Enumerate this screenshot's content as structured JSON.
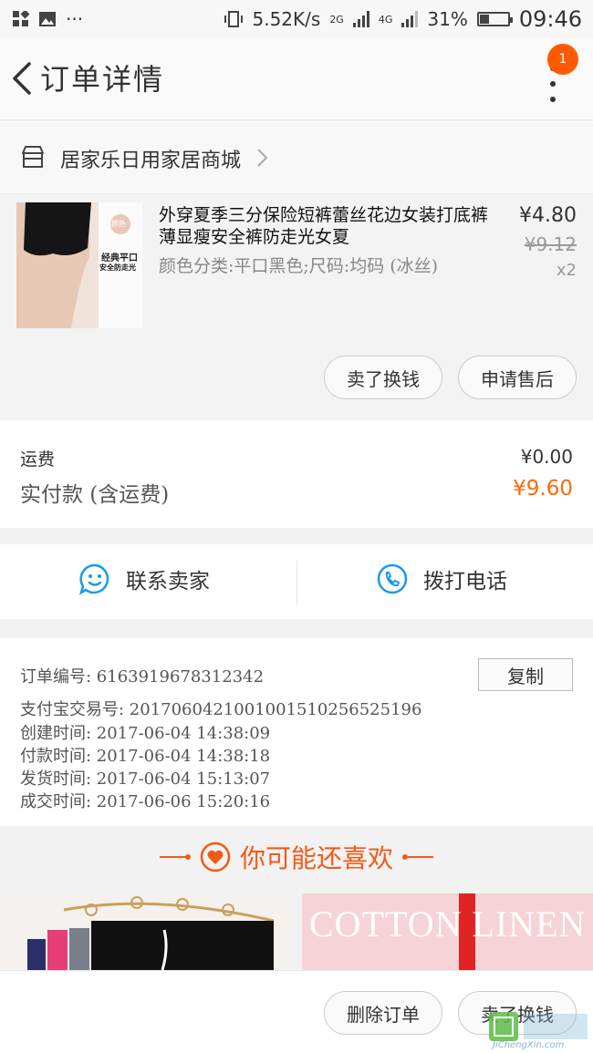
{
  "status_bar": {
    "speed": "5.52K/s",
    "net1": "2G",
    "net2": "4G",
    "battery": "31%",
    "time": "09:46"
  },
  "header": {
    "title": "订单详情",
    "badge": "1"
  },
  "shop": {
    "name": "居家乐日用家居商城"
  },
  "product": {
    "title": "外穿夏季三分保险短裤蕾丝花边女装打底裤薄显瘦安全裤防走光女夏",
    "spec": "颜色分类:平口黑色;尺码:均码 (冰丝)",
    "price": "¥4.80",
    "original_price": "¥9.12",
    "quantity": "x2",
    "image_labels": [
      "颜色",
      "经典平口",
      "安全防走光"
    ]
  },
  "actions": {
    "sell_label": "卖了换钱",
    "after_sale_label": "申请售后"
  },
  "fees": {
    "shipping_label": "运费",
    "shipping_value": "¥0.00",
    "paid_label": "实付款 (含运费)",
    "paid_value": "¥9.60"
  },
  "contact": {
    "seller_label": "联系卖家",
    "phone_label": "拨打电话"
  },
  "order_info": {
    "order_no": "订单编号: 6163919678312342",
    "copy_label": "复制",
    "alipay_no": "支付宝交易号: 2017060421001001510256525196",
    "created": "创建时间: 2017-06-04 14:38:09",
    "paid": "付款时间: 2017-06-04 14:38:18",
    "shipped": "发货时间: 2017-06-04 15:13:07",
    "completed": "成交时间: 2017-06-06 15:20:16"
  },
  "recommend": {
    "title": "你可能还喜欢"
  },
  "goods": {
    "banner_text": "COTTON LINEN"
  },
  "bottom": {
    "delete_label": "删除订单",
    "sell_label": "卖了换钱"
  },
  "watermark": {
    "site": "JiChengXin.com"
  },
  "colors": {
    "accent": "#ff6a00",
    "recommend": "#f25a16",
    "icon_blue": "#1a9be6"
  },
  "icons": [
    "back-icon",
    "more-icon",
    "shop-icon",
    "chevron-right-icon",
    "chat-icon",
    "phone-icon",
    "heart-icon"
  ]
}
